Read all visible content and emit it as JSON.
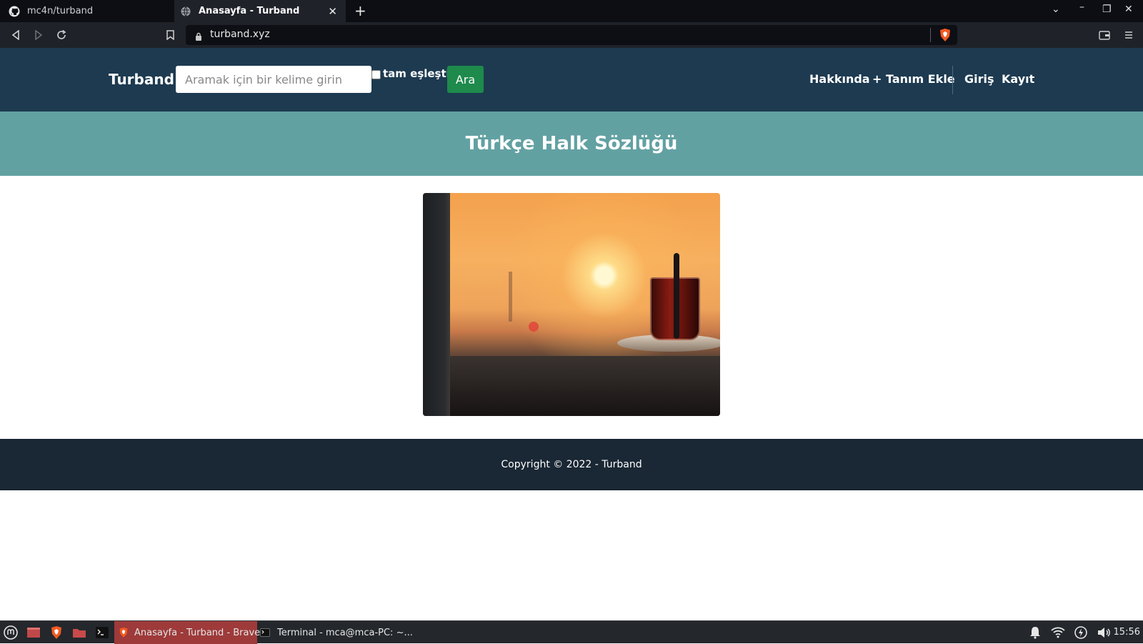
{
  "browser": {
    "tabs": [
      {
        "title": "mc4n/turband",
        "icon": "github-icon",
        "active": false
      },
      {
        "title": "Anasayfa - Turband",
        "icon": "globe-icon",
        "active": true
      }
    ],
    "url": "turband.xyz"
  },
  "site": {
    "brand": "Turband",
    "search": {
      "placeholder": "Aramak için bir kelime girin",
      "value": ""
    },
    "exact_match_label": "tam eşleştir",
    "search_button": "Ara",
    "nav": {
      "about": "Hakkında",
      "add_definition": "+ Tanım Ekle",
      "login": "Giriş",
      "register": "Kayıt"
    },
    "banner_title": "Türkçe Halk Sözlüğü",
    "footer": "Copyright © 2022 - Turband"
  },
  "taskbar": {
    "tasks": [
      {
        "label": "Anasayfa - Turband - Brave",
        "active": true
      },
      {
        "label": "Terminal - mca@mca-PC: ~...",
        "active": false
      }
    ],
    "clock": "15:56"
  },
  "colors": {
    "header": "#1d3a50",
    "banner": "#62a1a2",
    "search_button": "#1e8a4c",
    "footer": "#1a2734"
  }
}
